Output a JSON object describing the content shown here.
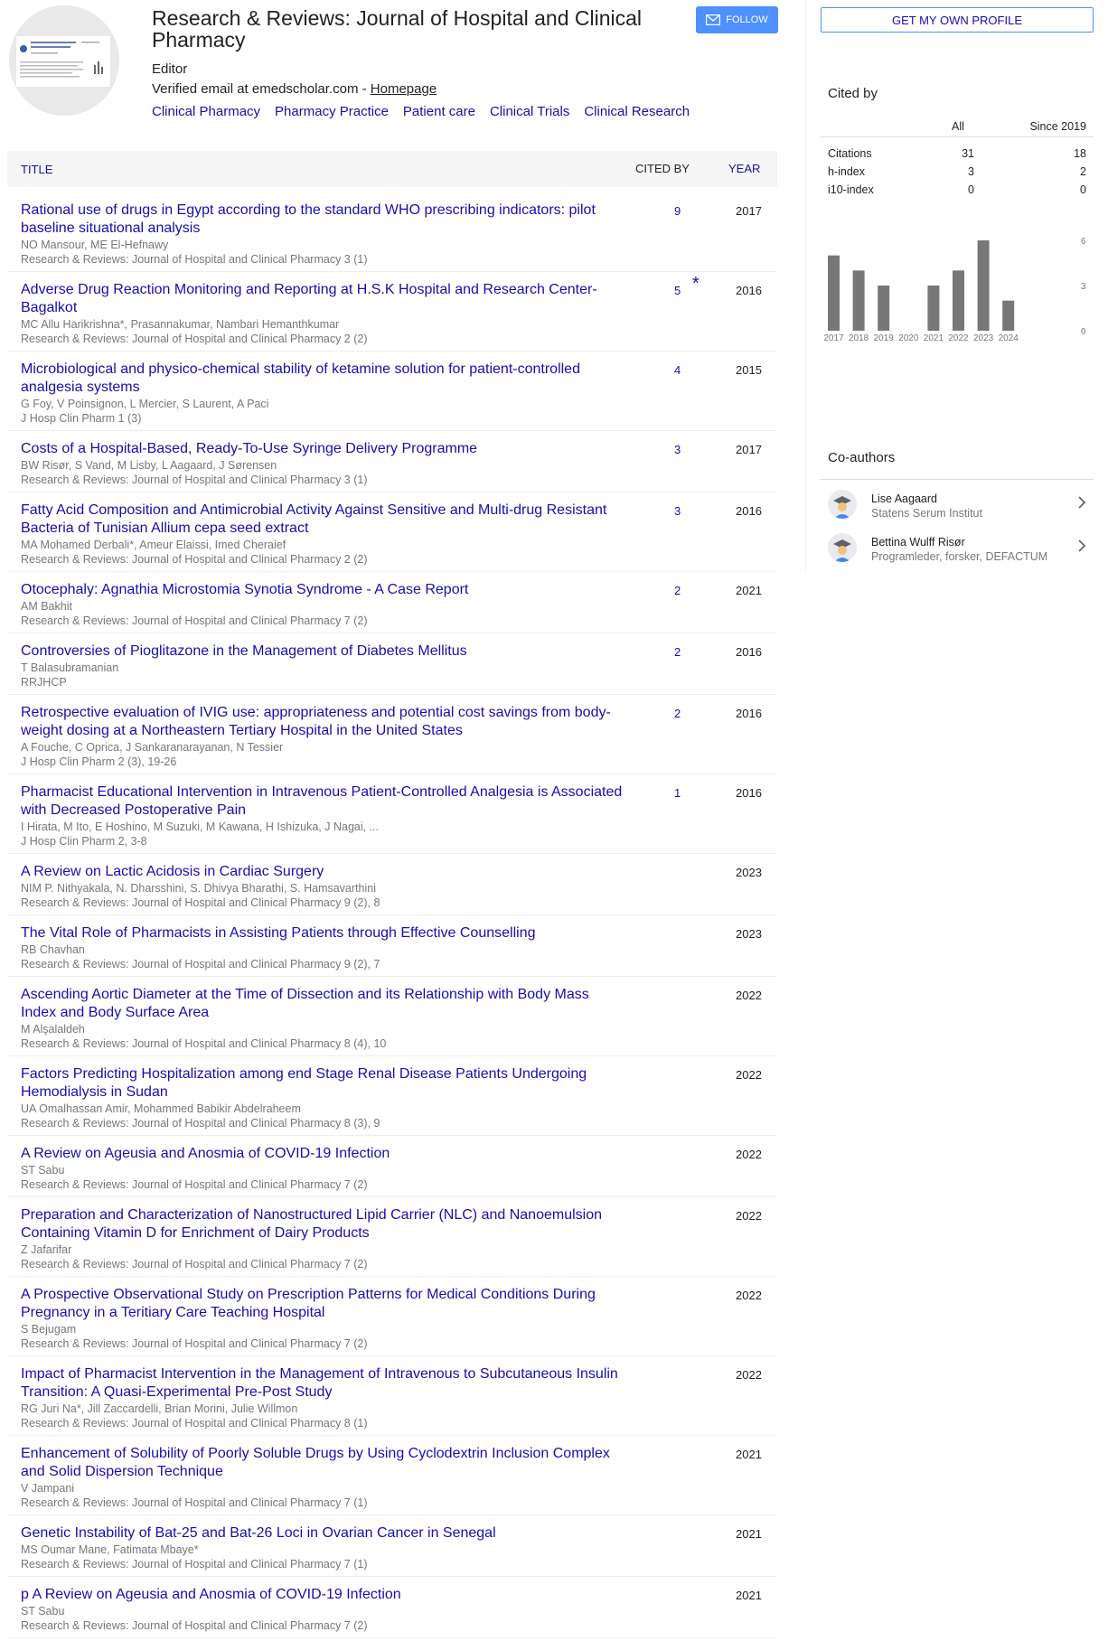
{
  "profile": {
    "name": "Research & Reviews: Journal of Hospital and Clinical Pharmacy",
    "affiliation": "Editor",
    "email_text": "Verified email at emedscholar.com - ",
    "homepage_label": "Homepage",
    "interests": [
      "Clinical Pharmacy",
      "Pharmacy Practice",
      "Patient care",
      "Clinical Trials",
      "Clinical Research"
    ],
    "follow_label": "FOLLOW"
  },
  "table": {
    "col_title": "TITLE",
    "col_cited": "CITED BY",
    "col_year": "YEAR",
    "rows": [
      {
        "title": "Rational use of drugs in Egypt according to the standard WHO prescribing indicators: pilot baseline situational analysis",
        "authors": "NO Mansour, ME El-Hefnawy",
        "venue": "Research & Reviews: Journal of Hospital and Clinical Pharmacy 3 (1)",
        "cited": "9",
        "star": "",
        "year": "2017"
      },
      {
        "title": "Adverse Drug Reaction Monitoring and Reporting at H.S.K Hospital and Research Center-Bagalkot",
        "authors": "MC Allu Harikrishna*, Prasannakumar, Nambari Hemanthkumar",
        "venue": "Research & Reviews: Journal of Hospital and Clinical Pharmacy 2 (2)",
        "cited": "5",
        "star": "*",
        "year": "2016"
      },
      {
        "title": "Microbiological and physico-chemical stability of ketamine solution for patient-controlled analgesia systems",
        "authors": "G Foy, V Poinsignon, L Mercier, S Laurent, A Paci",
        "venue": "J Hosp Clin Pharm 1 (3)",
        "cited": "4",
        "star": "",
        "year": "2015"
      },
      {
        "title": "Costs of a Hospital-Based, Ready-To-Use Syringe Delivery Programme",
        "authors": "BW Risør, S Vand, M Lisby, L Aagaard, J Sørensen",
        "venue": "Research & Reviews: Journal of Hospital and Clinical Pharmacy 3 (1)",
        "cited": "3",
        "star": "",
        "year": "2017"
      },
      {
        "title": "Fatty Acid Composition and Antimicrobial Activity Against Sensitive and Multi-drug Resistant Bacteria of Tunisian Allium cepa seed extract",
        "authors": "MA Mohamed Derbali*, Ameur Elaissi, Imed Cheraief",
        "venue": "Research & Reviews: Journal of Hospital and Clinical Pharmacy 2 (2)",
        "cited": "3",
        "star": "",
        "year": "2016"
      },
      {
        "title": "Otocephaly: Agnathia Microstomia Synotia Syndrome - A Case Report",
        "authors": "AM Bakhit",
        "venue": "Research & Reviews: Journal of Hospital and Clinical Pharmacy 7 (2)",
        "cited": "2",
        "star": "",
        "year": "2021"
      },
      {
        "title": "Controversies of Pioglitazone in the Management of Diabetes Mellitus",
        "authors": "T Balasubramanian",
        "venue": "RRJHCP",
        "cited": "2",
        "star": "",
        "year": "2016"
      },
      {
        "title": "Retrospective evaluation of IVIG use: appropriateness and potential cost savings from body-weight dosing at a Northeastern Tertiary Hospital in the United States",
        "authors": "A Fouche, C Oprica, J Sankaranarayanan, N Tessier",
        "venue": "J Hosp Clin Pharm 2 (3), 19-26",
        "cited": "2",
        "star": "",
        "year": "2016"
      },
      {
        "title": "Pharmacist Educational Intervention in Intravenous Patient-Controlled Analgesia is Associated with Decreased Postoperative Pain",
        "authors": "I Hirata, M Ito, E Hoshino, M Suzuki, M Kawana, H Ishizuka, J Nagai, ...",
        "venue": "J Hosp Clin Pharm 2, 3-8",
        "cited": "1",
        "star": "",
        "year": "2016"
      },
      {
        "title": "A Review on Lactic Acidosis in Cardiac Surgery",
        "authors": "NIM P. Nithyakala, N. Dharsshini, S. Dhivya Bharathi, S. Hamsavarthini",
        "venue": "Research & Reviews: Journal of Hospital and Clinical Pharmacy 9 (2), 8",
        "cited": "",
        "star": "",
        "year": "2023"
      },
      {
        "title": "The Vital Role of Pharmacists in Assisting Patients through Effective Counselling",
        "authors": "RB Chavhan",
        "venue": "Research & Reviews: Journal of Hospital and Clinical Pharmacy 9 (2), 7",
        "cited": "",
        "star": "",
        "year": "2023"
      },
      {
        "title": "Ascending Aortic Diameter at the Time of Dissection and its Relationship with Body Mass Index and Body Surface Area",
        "authors": "M Alşalaldeh",
        "venue": "Research & Reviews: Journal of Hospital and Clinical Pharmacy 8 (4), 10",
        "cited": "",
        "star": "",
        "year": "2022"
      },
      {
        "title": "Factors Predicting Hospitalization among end Stage Renal Disease Patients Undergoing Hemodialysis in Sudan",
        "authors": "UA Omalhassan Amir, Mohammed Babikir Abdelraheem",
        "venue": "Research & Reviews: Journal of Hospital and Clinical Pharmacy 8 (3), 9",
        "cited": "",
        "star": "",
        "year": "2022"
      },
      {
        "title": "A Review on Ageusia and Anosmia of COVID-19 Infection",
        "authors": "ST Sabu",
        "venue": "Research & Reviews: Journal of Hospital and Clinical Pharmacy 7 (2)",
        "cited": "",
        "star": "",
        "year": "2022"
      },
      {
        "title": "Preparation and Characterization of Nanostructured Lipid Carrier (NLC) and Nanoemulsion Containing Vitamin D for Enrichment of Dairy Products",
        "authors": "Z Jafarifar",
        "venue": "Research & Reviews: Journal of Hospital and Clinical Pharmacy 7 (2)",
        "cited": "",
        "star": "",
        "year": "2022"
      },
      {
        "title": "A Prospective Observational Study on Prescription Patterns for Medical Conditions During Pregnancy in a Teritiary Care Teaching Hospital",
        "authors": "S Bejugam",
        "venue": "Research & Reviews: Journal of Hospital and Clinical Pharmacy 7 (2)",
        "cited": "",
        "star": "",
        "year": "2022"
      },
      {
        "title": "Impact of Pharmacist Intervention in the Management of Intravenous to Subcutaneous Insulin Transition: A Quasi-Experimental Pre-Post Study",
        "authors": "RG Juri Na*, Jill Zaccardelli, Brian Morini, Julie Willmon",
        "venue": "Research & Reviews: Journal of Hospital and Clinical Pharmacy 8 (1)",
        "cited": "",
        "star": "",
        "year": "2022"
      },
      {
        "title": "Enhancement of Solubility of Poorly Soluble Drugs by Using Cyclodextrin Inclusion Complex and Solid Dispersion Technique",
        "authors": "V Jampani",
        "venue": "Research & Reviews: Journal of Hospital and Clinical Pharmacy 7 (1)",
        "cited": "",
        "star": "",
        "year": "2021"
      },
      {
        "title": "Genetic Instability of Bat-25 and Bat-26 Loci in Ovarian Cancer in Senegal",
        "authors": "MS Oumar Mane, Fatimata Mbaye*",
        "venue": "Research & Reviews: Journal of Hospital and Clinical Pharmacy 7 (1)",
        "cited": "",
        "star": "",
        "year": "2021"
      },
      {
        "title": "p A Review on Ageusia and Anosmia of COVID-19 Infection",
        "authors": "ST Sabu",
        "venue": "Research & Reviews: Journal of Hospital and Clinical Pharmacy 7 (2)",
        "cited": "",
        "star": "",
        "year": "2021"
      }
    ]
  },
  "sidebar": {
    "own_profile_label": "GET MY OWN PROFILE",
    "cited_by_heading": "Cited by",
    "stats_header": {
      "all": "All",
      "since": "Since 2019"
    },
    "stats": [
      {
        "label": "Citations",
        "all": "31",
        "since": "18"
      },
      {
        "label": "h-index",
        "all": "3",
        "since": "2"
      },
      {
        "label": "i10-index",
        "all": "0",
        "since": "0"
      }
    ],
    "coauthors_heading": "Co-authors",
    "coauthors": [
      {
        "name": "Lise Aagaard",
        "affiliation": "Statens Serum Institut"
      },
      {
        "name": "Bettina Wulff Risør",
        "affiliation": "Programleder, forsker, DEFACTUM"
      }
    ]
  },
  "chart_data": {
    "type": "bar",
    "categories": [
      "2017",
      "2018",
      "2019",
      "2020",
      "2021",
      "2022",
      "2023",
      "2024"
    ],
    "values": [
      5,
      4,
      3,
      0,
      3,
      4,
      6,
      2
    ],
    "yticks": [
      "6",
      "3",
      "0"
    ],
    "ylim": [
      0,
      6
    ],
    "bar_color": "#777777"
  },
  "colors": {
    "link": "#1a0dab",
    "follow_bg": "#4d90fe",
    "meta_text": "#777777"
  },
  "icons": {
    "follow": "envelope-icon",
    "coauthor": "graduation-avatar-icon",
    "coauthor_action": "chevron-right-icon"
  }
}
